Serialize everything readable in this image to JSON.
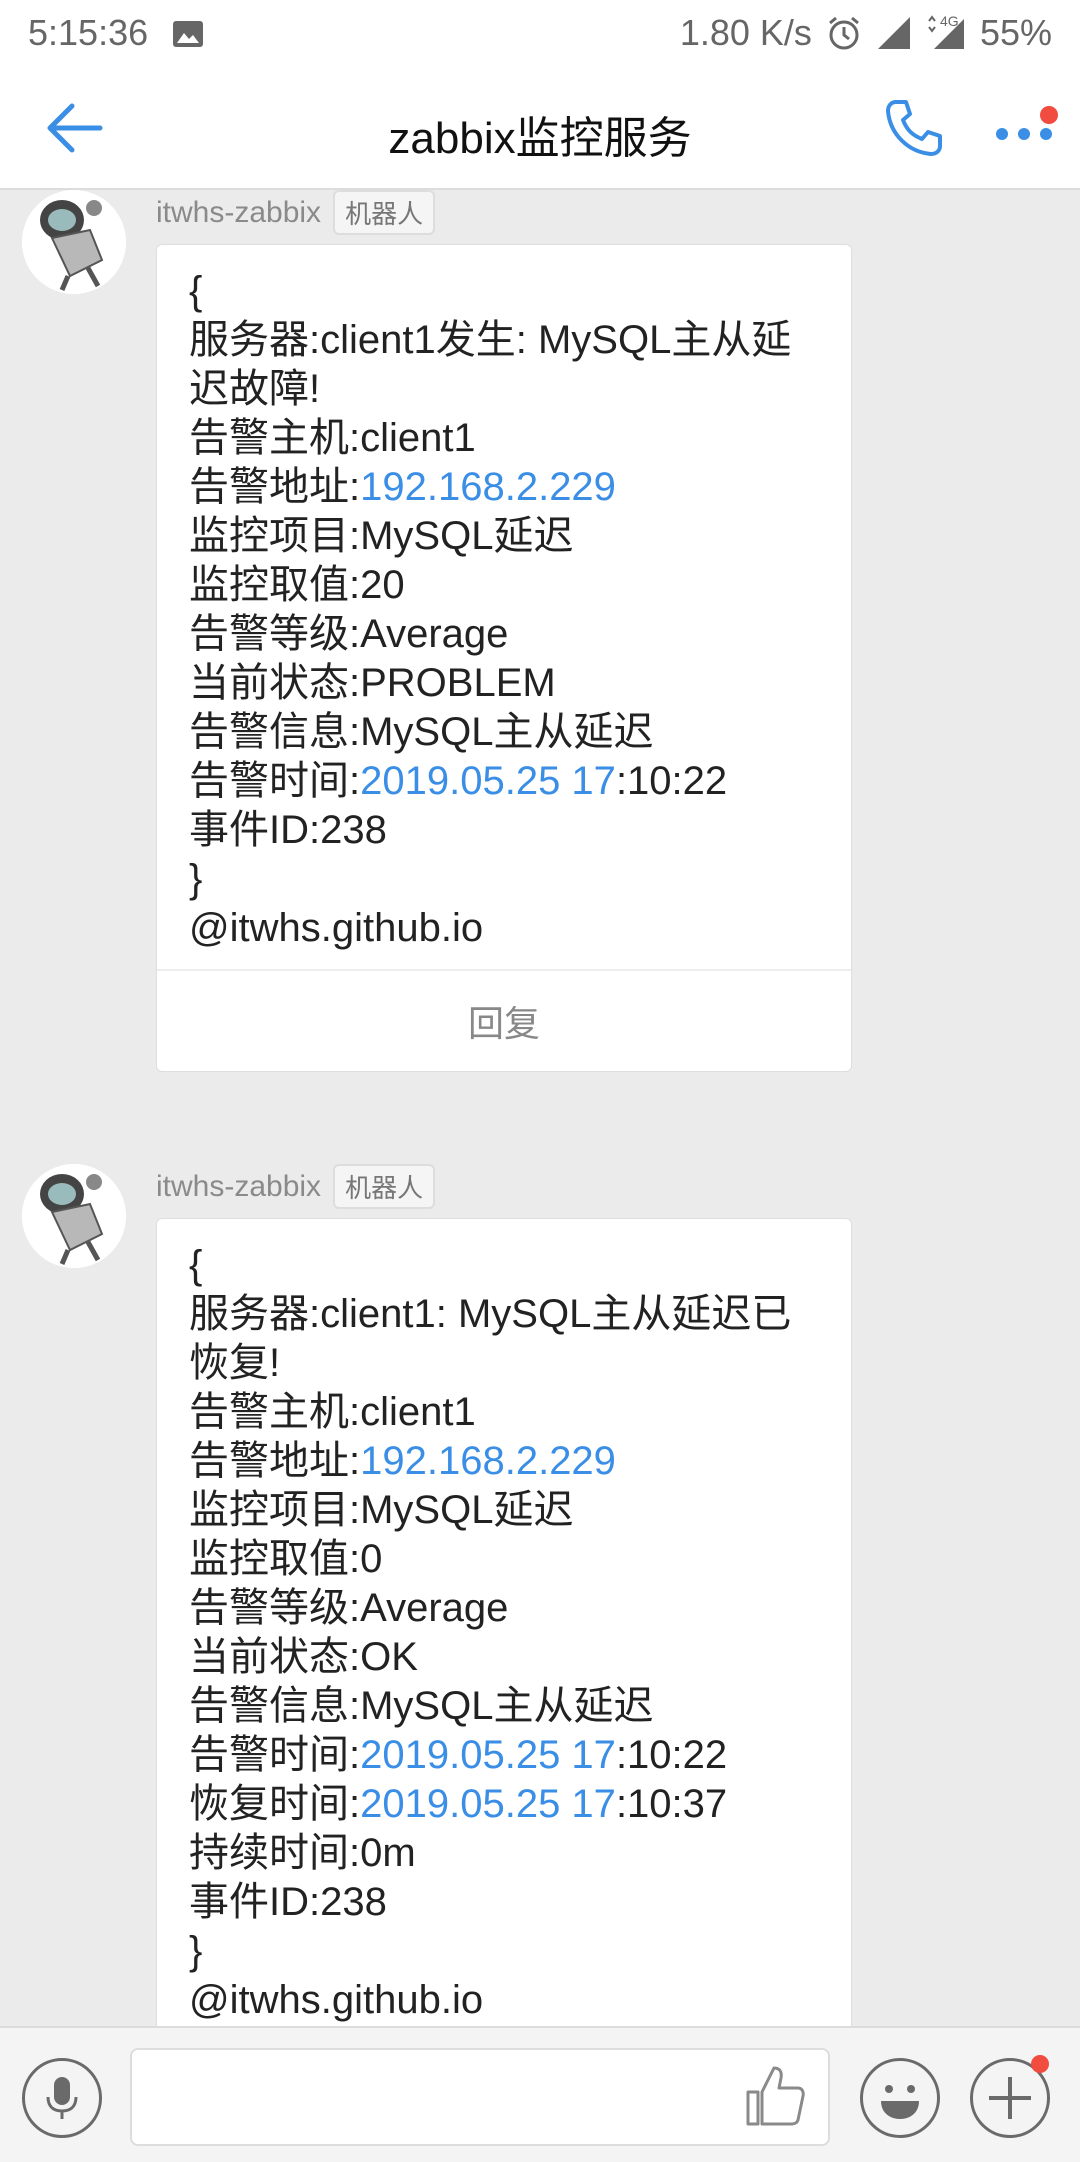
{
  "status_bar": {
    "time": "5:15:36",
    "net_speed": "1.80 K/s",
    "network_type": "4G",
    "battery": "55%"
  },
  "header": {
    "title": "zabbix监控服务",
    "back_icon": "arrow-left-icon",
    "call_icon": "phone-icon",
    "more_icon": "more-dots-icon",
    "accent_color": "#3a8ee6",
    "notification_color": "#f24b3f"
  },
  "messages": [
    {
      "sender": "itwhs-zabbix",
      "badge": "机器人",
      "reply_label": "回复",
      "lines": [
        {
          "text": "{"
        },
        {
          "text": "服务器:client1发生: MySQL主从延迟故障!",
          "wrap": true
        },
        {
          "text": "告警主机:client1"
        },
        {
          "prefix": "告警地址:",
          "link": "192.168.2.229",
          "suffix": ""
        },
        {
          "text": "监控项目:MySQL延迟"
        },
        {
          "text": "监控取值:20"
        },
        {
          "text": "告警等级:Average"
        },
        {
          "text": "当前状态:PROBLEM"
        },
        {
          "text": "告警信息:MySQL主从延迟"
        },
        {
          "prefix": "告警时间:",
          "link": "2019.05.25 17",
          "suffix": ":10:22"
        },
        {
          "text": "事件ID:238"
        },
        {
          "text": "}"
        },
        {
          "text": "@itwhs.github.io"
        }
      ]
    },
    {
      "sender": "itwhs-zabbix",
      "badge": "机器人",
      "lines": [
        {
          "text": "{"
        },
        {
          "text": "服务器:client1: MySQL主从延迟已恢复!",
          "wrap": true
        },
        {
          "text": "告警主机:client1"
        },
        {
          "prefix": "告警地址:",
          "link": "192.168.2.229",
          "suffix": ""
        },
        {
          "text": "监控项目:MySQL延迟"
        },
        {
          "text": "监控取值:0"
        },
        {
          "text": "告警等级:Average"
        },
        {
          "text": "当前状态:OK"
        },
        {
          "text": "告警信息:MySQL主从延迟"
        },
        {
          "prefix": "告警时间:",
          "link": "2019.05.25 17",
          "suffix": ":10:22"
        },
        {
          "prefix": "恢复时间:",
          "link": "2019.05.25 17",
          "suffix": ":10:37"
        },
        {
          "text": "持续时间:0m"
        },
        {
          "text": "事件ID:238"
        },
        {
          "text": "}"
        },
        {
          "text": "@itwhs.github.io"
        }
      ]
    }
  ],
  "input_bar": {
    "placeholder": "",
    "voice_icon": "microphone-icon",
    "like_icon": "thumbs-up-icon",
    "emoji_icon": "smiley-icon",
    "plus_icon": "plus-icon"
  }
}
